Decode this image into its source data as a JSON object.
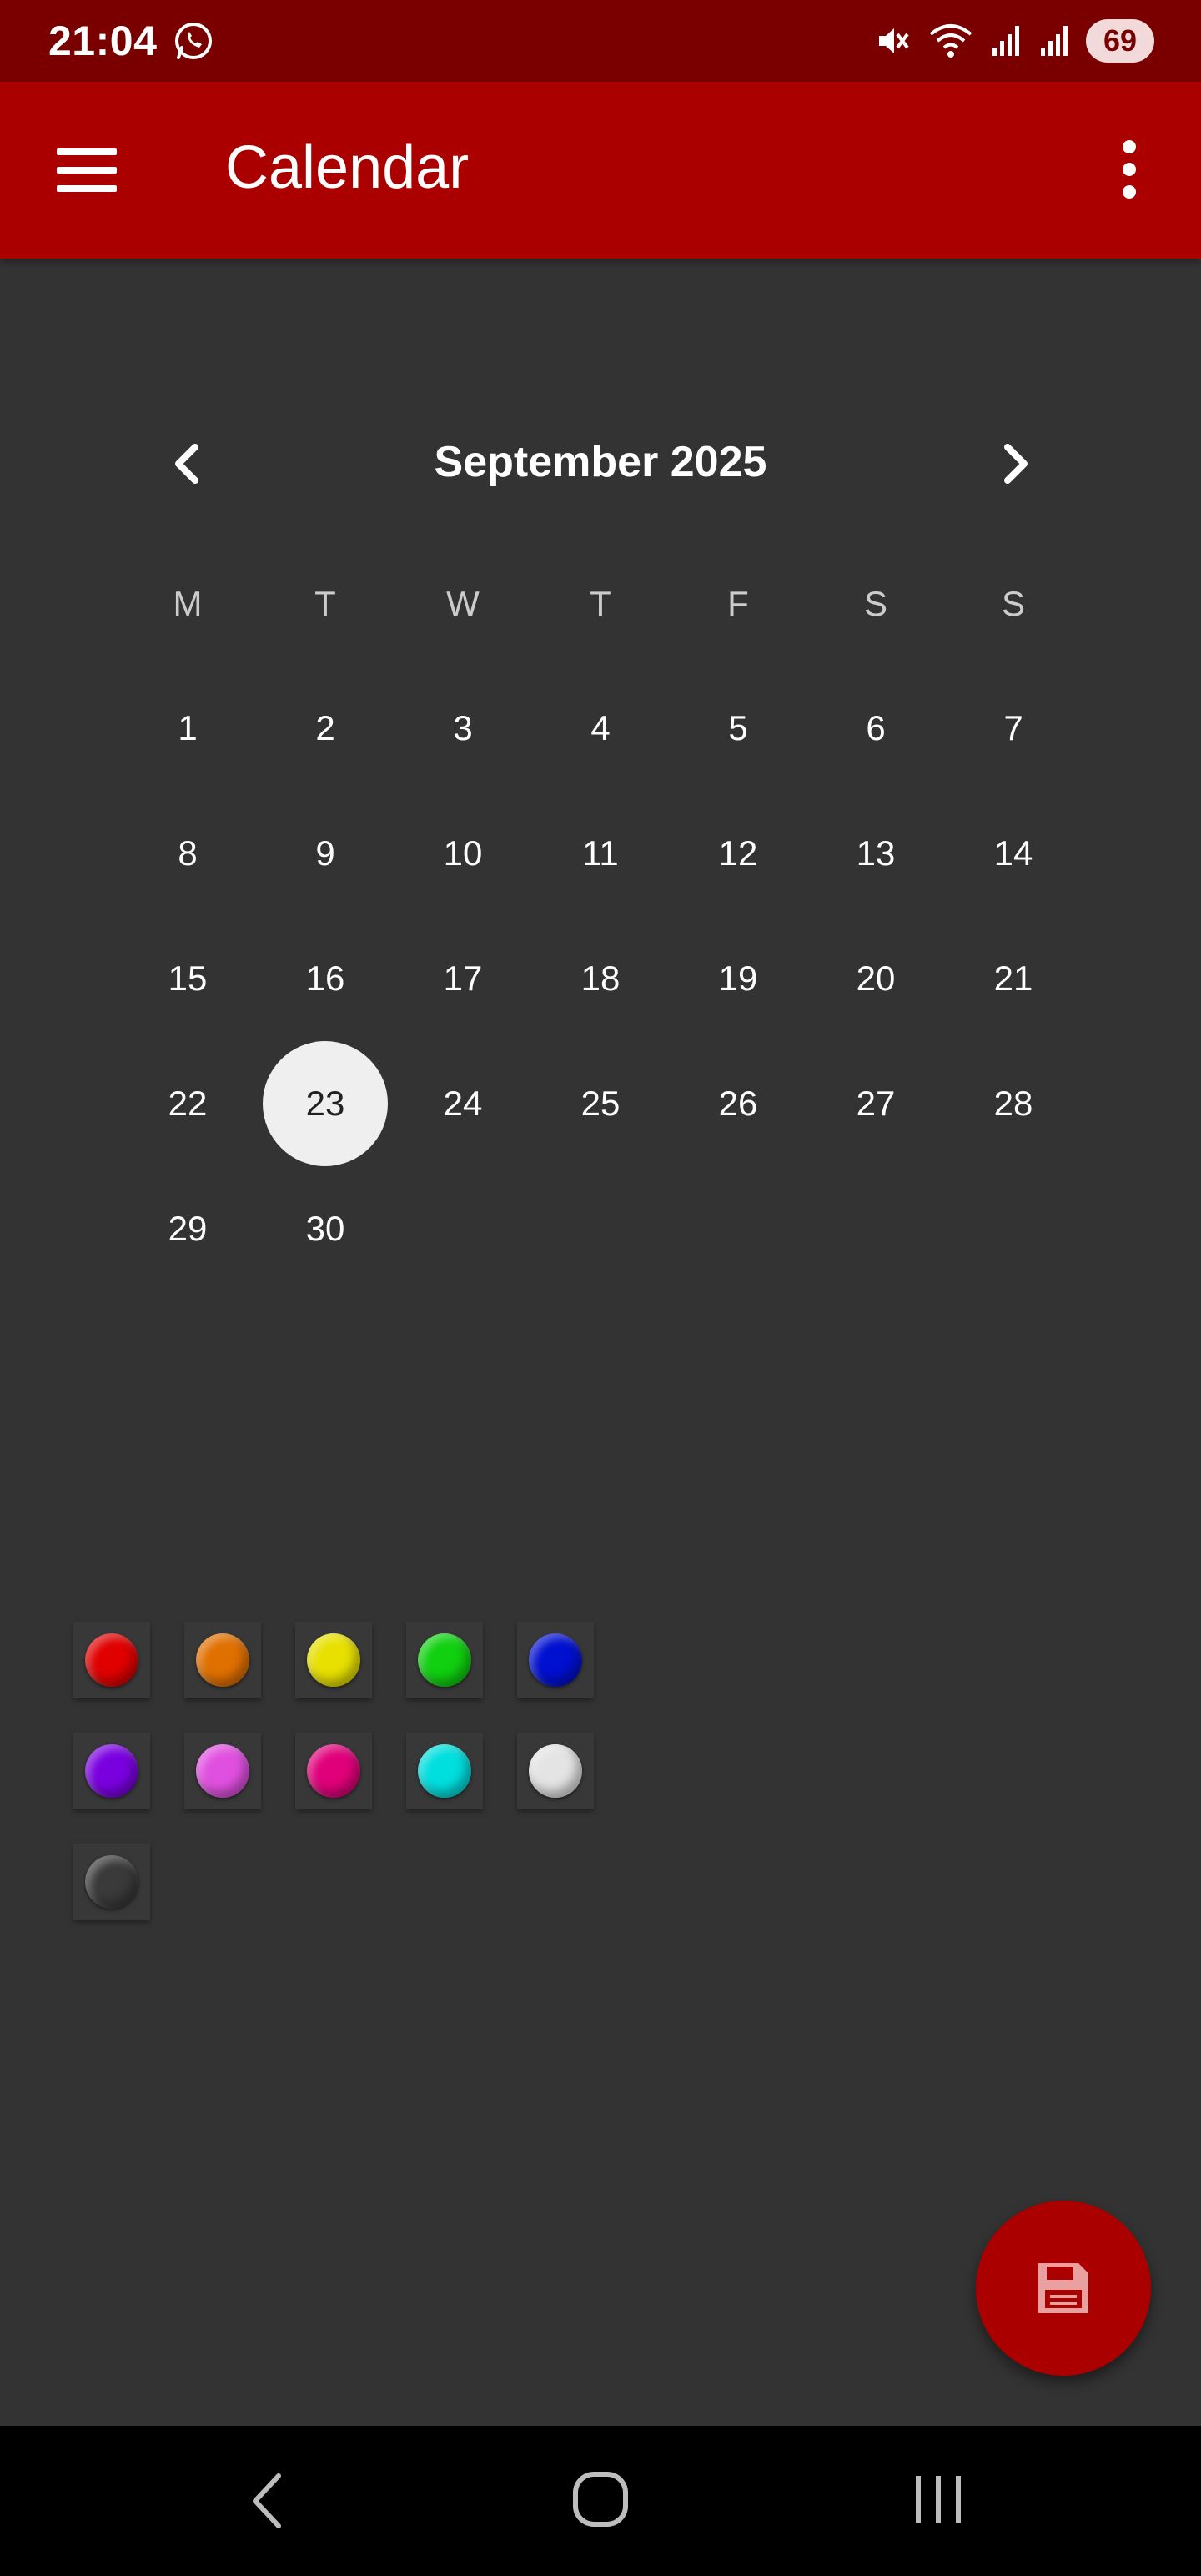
{
  "status_bar": {
    "time": "21:04",
    "battery": "69"
  },
  "app_bar": {
    "title": "Calendar"
  },
  "calendar": {
    "month_label": "September 2025",
    "weekdays": [
      "M",
      "T",
      "W",
      "T",
      "F",
      "S",
      "S"
    ],
    "weeks": [
      [
        "1",
        "2",
        "3",
        "4",
        "5",
        "6",
        "7"
      ],
      [
        "8",
        "9",
        "10",
        "11",
        "12",
        "13",
        "14"
      ],
      [
        "15",
        "16",
        "17",
        "18",
        "19",
        "20",
        "21"
      ],
      [
        "22",
        "23",
        "24",
        "25",
        "26",
        "27",
        "28"
      ],
      [
        "29",
        "30",
        "",
        "",
        "",
        "",
        ""
      ]
    ],
    "selected_day": "23"
  },
  "color_palette": [
    {
      "name": "red",
      "color": "#e00000"
    },
    {
      "name": "orange",
      "color": "#e07000"
    },
    {
      "name": "yellow",
      "color": "#e8e000"
    },
    {
      "name": "green",
      "color": "#10d010"
    },
    {
      "name": "blue",
      "color": "#0010d0"
    },
    {
      "name": "purple",
      "color": "#7a00e0"
    },
    {
      "name": "pink",
      "color": "#e050e0"
    },
    {
      "name": "magenta",
      "color": "#e0007a"
    },
    {
      "name": "cyan",
      "color": "#00dede"
    },
    {
      "name": "white",
      "color": "#e4e4e4"
    },
    {
      "name": "dark-gray",
      "color": "#3a3a3a"
    }
  ],
  "fab": {
    "icon": "save-icon"
  },
  "colors": {
    "status_bar": "#7a0000",
    "app_bar": "#aa0000",
    "background": "#333333",
    "selected_day": "#efefef",
    "fab": "#aa0000"
  }
}
